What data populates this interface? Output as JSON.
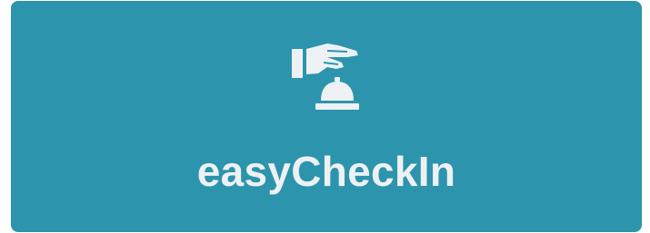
{
  "card": {
    "title": "easyCheckIn",
    "icon": "concierge-bell-hand-icon",
    "background_color": "#2c94ac",
    "text_color": "#eef1f3"
  }
}
